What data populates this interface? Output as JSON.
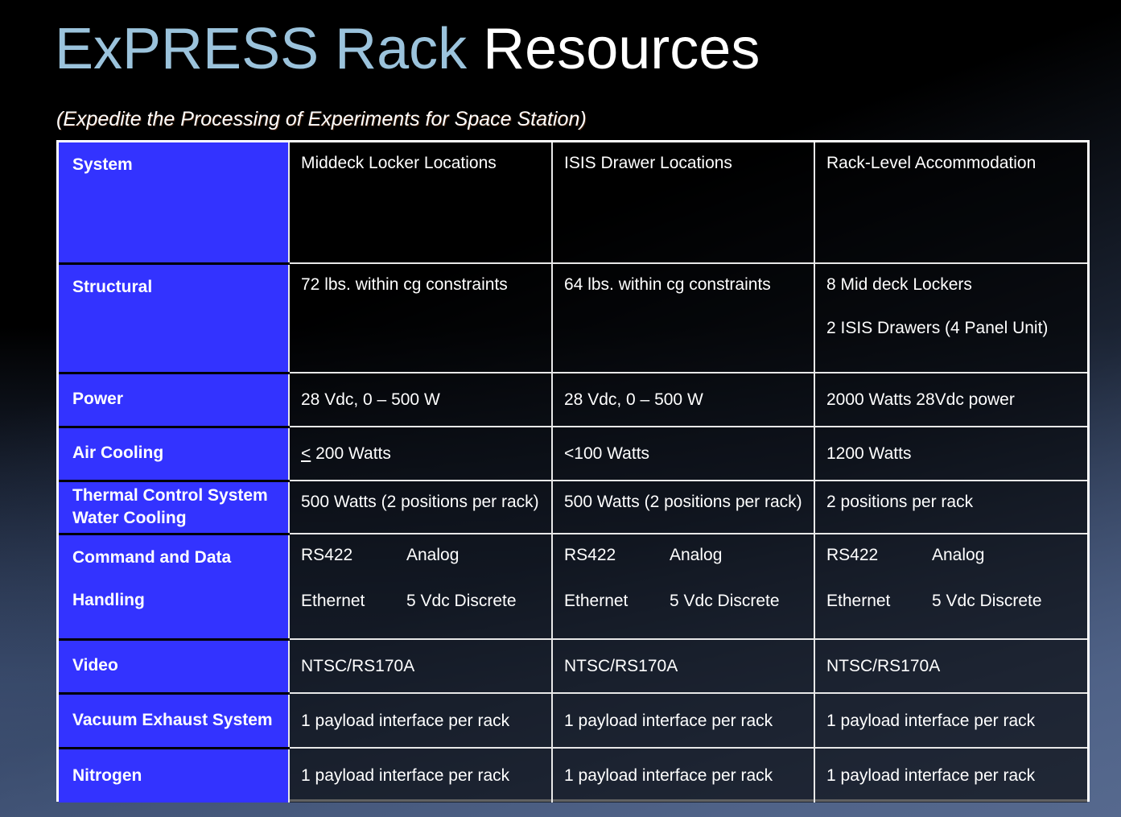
{
  "slide": {
    "title_primary": "ExPRESS Rack",
    "title_secondary": "Resources",
    "subtitle": "(Expedite the Processing of Experiments for Space Station)",
    "colors": {
      "title_accent": "#9BC3DC",
      "title_main": "#FFFFFF",
      "label_cell": "#3333FF",
      "background_bottom": "#4A5E85",
      "background_top": "#000000",
      "table_border": "#FFFFFF"
    }
  },
  "table": {
    "columns": [
      "System",
      "Middeck Locker Locations",
      "ISIS Drawer Locations",
      "Rack-Level Accommodation"
    ],
    "rows": [
      {
        "label": "Structural",
        "middeck": "72 lbs. within cg constraints",
        "isis": "64 lbs. within cg constraints",
        "rack_line1": "8 Mid deck Lockers",
        "rack_line2": "2 ISIS Drawers (4 Panel Unit)"
      },
      {
        "label": "Power",
        "middeck": "28 Vdc, 0 – 500 W",
        "isis": "28 Vdc, 0 – 500 W",
        "rack": "2000 Watts 28Vdc power"
      },
      {
        "label": "Air Cooling",
        "middeck_symbol": "<",
        "middeck_rest": " 200 Watts",
        "isis": "<100 Watts",
        "rack": "1200 Watts"
      },
      {
        "label": "Thermal Control System Water Cooling",
        "middeck": "500 Watts (2 positions per rack)",
        "isis": "500 Watts (2 positions per rack)",
        "rack": "2 positions per rack"
      },
      {
        "label_line1": "Command and Data",
        "label_line2": "Handling",
        "cdh": {
          "bus": "RS422",
          "analog": "Analog",
          "ethernet": "Ethernet",
          "discrete": "5 Vdc Discrete"
        }
      },
      {
        "label": "Video",
        "middeck": "NTSC/RS170A",
        "isis": "NTSC/RS170A",
        "rack": "NTSC/RS170A"
      },
      {
        "label": "Vacuum Exhaust System",
        "middeck": "1 payload interface per rack",
        "isis": "1 payload interface per rack",
        "rack": "1 payload interface per rack"
      },
      {
        "label": "Nitrogen",
        "middeck": "1 payload interface per rack",
        "isis": "1 payload interface per rack",
        "rack": "1 payload interface per rack"
      }
    ]
  }
}
